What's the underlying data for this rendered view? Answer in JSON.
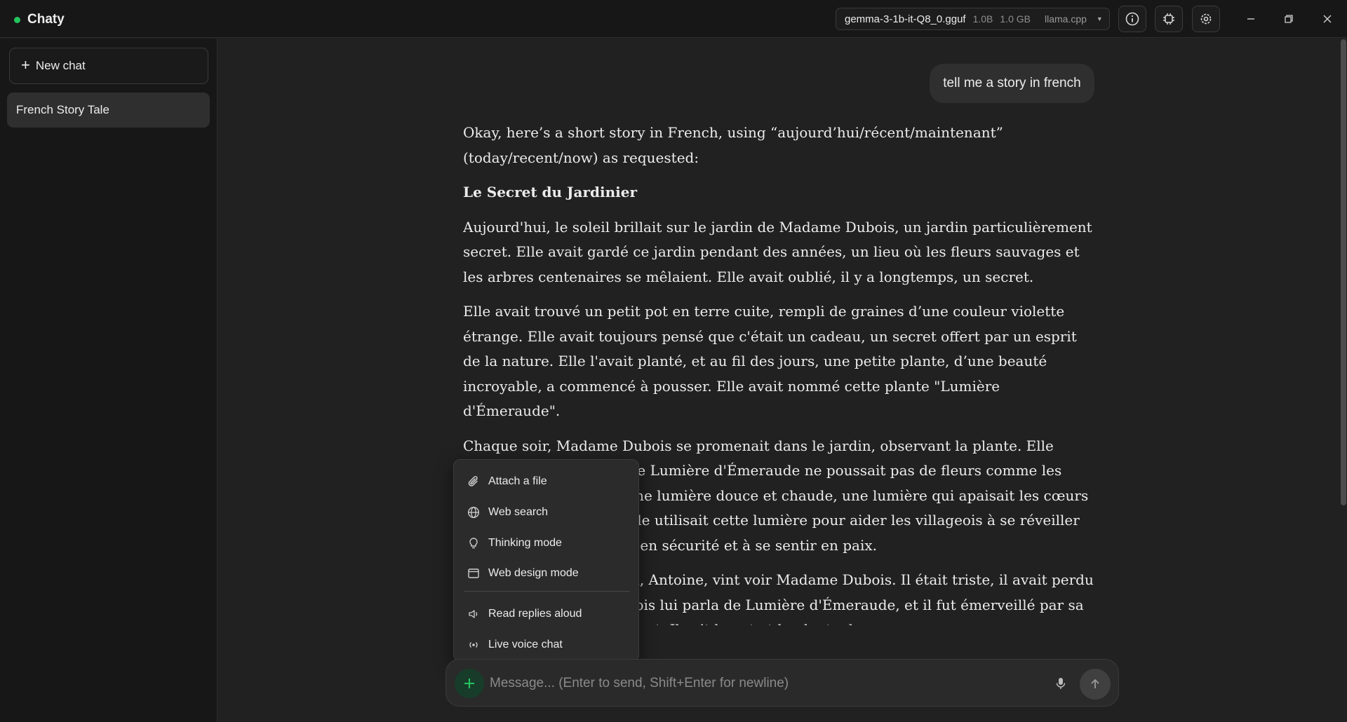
{
  "app": {
    "title": "Chaty"
  },
  "model": {
    "name": "gemma-3-1b-it-Q8_0.gguf",
    "params": "1.0B",
    "size": "1.0 GB",
    "engine": "llama.cpp"
  },
  "sidebar": {
    "new_chat_label": "New chat",
    "chats": [
      {
        "title": "French Story Tale",
        "active": true
      }
    ]
  },
  "conversation": {
    "user_message": "tell me a story in french",
    "assistant_paragraphs": [
      "Okay, here’s a short story in French, using “aujourd’hui/récent/maintenant” (today/recent/now) as requested:",
      "Le Secret du Jardinier",
      "Aujourd'hui, le soleil brillait sur le jardin de Madame Dubois, un jardin particulièrement secret. Elle avait gardé ce jardin pendant des années, un lieu où les fleurs sauvages et les arbres centenaires se mêlaient. Elle avait oublié, il y a longtemps, un secret.",
      "Elle avait trouvé un petit pot en terre cuite, rempli de graines d’une couleur violette étrange. Elle avait toujours pensé que c'était un cadeau, un secret offert par un esprit de la nature. Elle l'avait planté, et au fil des jours, une petite plante, d’une beauté incroyable, a commencé à pousser. Elle avait nommé cette plante \"Lumière d'Émeraude\".",
      "Chaque soir, Madame Dubois se promenait dans le jardin, observant la plante. Elle savait, au fond d'elle, que Lumière d'Émeraude ne poussait pas de fleurs comme les autres. Elle produisait une lumière douce et chaude, une lumière qui apaisait les cœurs et illuminait les nuits. Elle utilisait cette lumière pour aider les villageois à se réveiller après la nuit, à se sentir en sécurité et à se sentir en paix.",
      "Un jour, un jeune garçon, Antoine, vint voir Madame Dubois. Il était triste, il avait perdu son chien. Madame Dubois lui parla de Lumière d'Émeraude, et il fut émerveillé par sa beauté et son effet apaisant. Il prit le pot et le planta dans son"
    ]
  },
  "menu": {
    "items": [
      {
        "label": "Attach a file",
        "icon": "paperclip-icon"
      },
      {
        "label": "Web search",
        "icon": "globe-icon"
      },
      {
        "label": "Thinking mode",
        "icon": "lightbulb-icon"
      },
      {
        "label": "Web design mode",
        "icon": "browser-window-icon"
      },
      {
        "label": "Read replies aloud",
        "icon": "speaker-icon"
      },
      {
        "label": "Live voice chat",
        "icon": "broadcast-icon"
      }
    ]
  },
  "composer": {
    "placeholder": "Message... (Enter to send, Shift+Enter for newline)",
    "value": ""
  },
  "colors": {
    "accent": "#22c55e",
    "background": "#212121",
    "sidebar": "#171717"
  }
}
